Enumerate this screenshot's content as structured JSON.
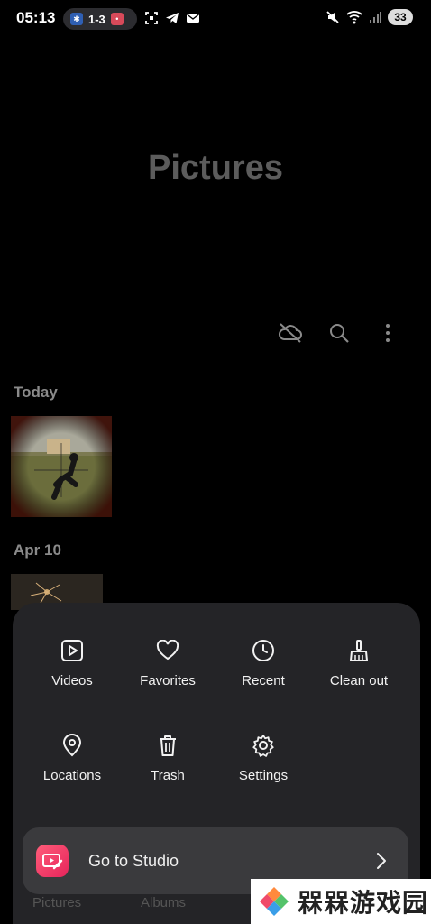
{
  "status_bar": {
    "time": "05:13",
    "score": "1-3",
    "battery": "33"
  },
  "page": {
    "title": "Pictures"
  },
  "sections": [
    {
      "header": "Today"
    },
    {
      "header": "Apr 10"
    }
  ],
  "menu": {
    "items": [
      {
        "label": "Videos",
        "icon": "video-icon"
      },
      {
        "label": "Favorites",
        "icon": "heart-icon"
      },
      {
        "label": "Recent",
        "icon": "clock-icon"
      },
      {
        "label": "Clean out",
        "icon": "broom-icon"
      },
      {
        "label": "Locations",
        "icon": "location-pin-icon"
      },
      {
        "label": "Trash",
        "icon": "trash-icon"
      },
      {
        "label": "Settings",
        "icon": "gear-icon"
      }
    ],
    "studio_label": "Go to Studio"
  },
  "bottom_nav": {
    "left": "Pictures",
    "right": "Albums"
  },
  "watermark": {
    "text": "槑槑游戏园"
  },
  "colors": {
    "sheet": "#242427",
    "accent": "#e6245b"
  }
}
